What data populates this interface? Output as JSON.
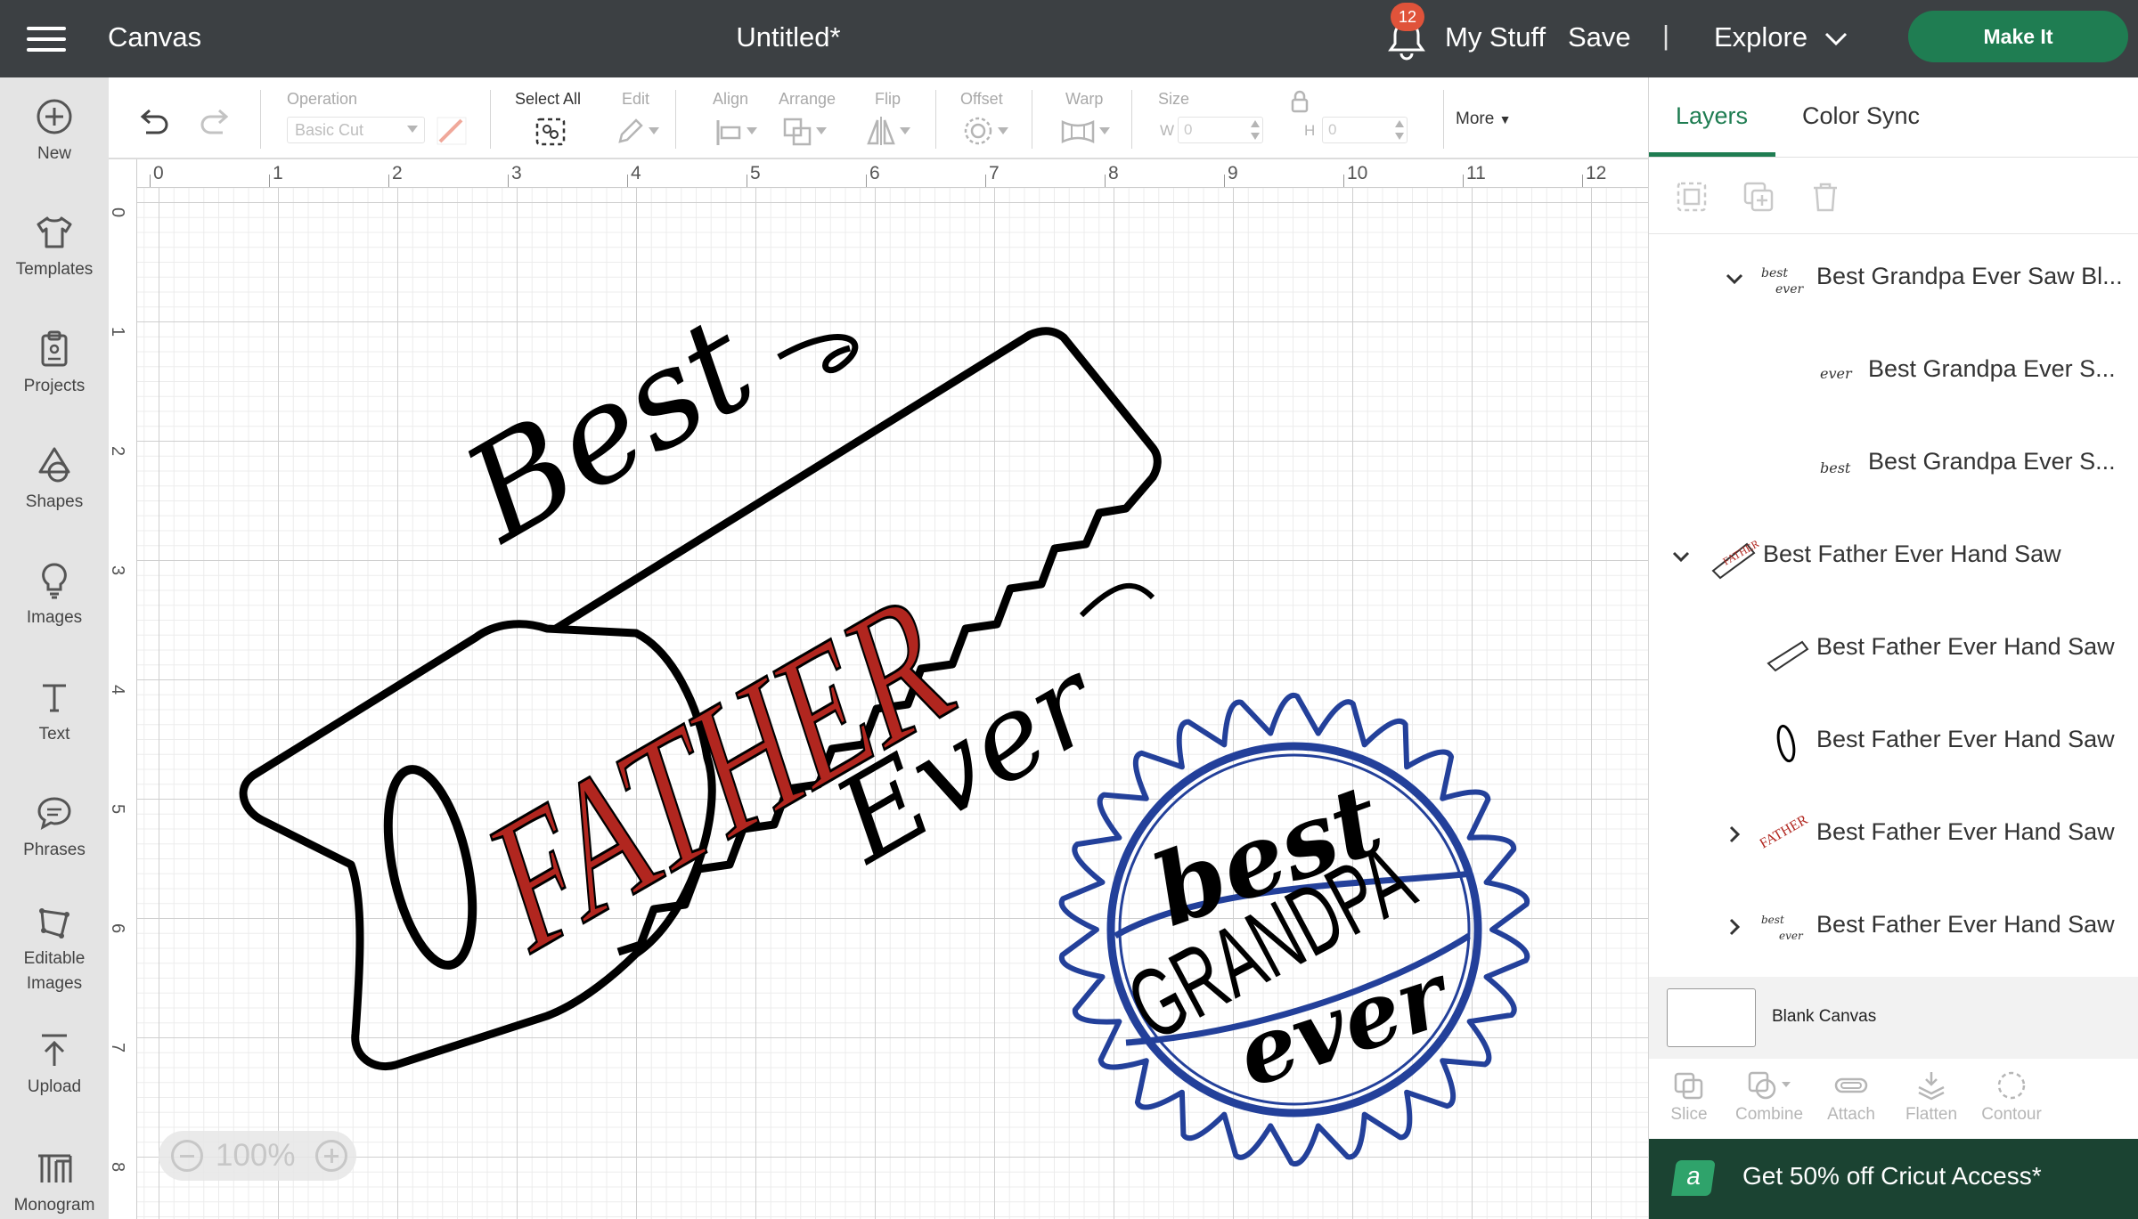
{
  "topbar": {
    "app_title": "Canvas",
    "doc_title": "Untitled*",
    "notifications_count": "12",
    "my_stuff": "My Stuff",
    "save": "Save",
    "separator": "|",
    "explore": "Explore",
    "make_it": "Make It"
  },
  "sidebar": {
    "items": [
      {
        "label": "New",
        "icon": "plus-circle-icon"
      },
      {
        "label": "Templates",
        "icon": "tshirt-icon"
      },
      {
        "label": "Projects",
        "icon": "clipboard-icon"
      },
      {
        "label": "Shapes",
        "icon": "shapes-icon"
      },
      {
        "label": "Images",
        "icon": "lightbulb-icon"
      },
      {
        "label": "Text",
        "icon": "text-t-icon"
      },
      {
        "label": "Phrases",
        "icon": "speech-bubble-icon"
      },
      {
        "label": "Editable",
        "label2": "Images",
        "icon": "editable-images-icon"
      },
      {
        "label": "Upload",
        "icon": "upload-arrow-icon"
      },
      {
        "label": "Monogram",
        "icon": "monogram-icon"
      }
    ]
  },
  "toolbar": {
    "operation_label": "Operation",
    "operation_value": "Basic Cut",
    "select_all": "Select All",
    "edit": "Edit",
    "align": "Align",
    "arrange": "Arrange",
    "flip": "Flip",
    "offset": "Offset",
    "warp": "Warp",
    "size": "Size",
    "w_letter": "W",
    "h_letter": "H",
    "w_value": "0",
    "h_value": "0",
    "more": "More"
  },
  "rulers": {
    "top": [
      "0",
      "1",
      "2",
      "3",
      "4",
      "5",
      "6",
      "7",
      "8",
      "9",
      "10",
      "11",
      "12"
    ],
    "left": [
      "0",
      "1",
      "2",
      "3",
      "4",
      "5",
      "6",
      "7",
      "8"
    ]
  },
  "zoom": {
    "value": "100%"
  },
  "canvas_art": {
    "saw": {
      "best": "Best",
      "father": "FATHER",
      "ever": "Ever"
    },
    "blade": {
      "best": "best",
      "grandpa": "GRANDPA",
      "ever": "ever"
    }
  },
  "panel": {
    "tab_layers": "Layers",
    "tab_color_sync": "Color Sync",
    "layers": [
      {
        "name": "Best Grandpa Ever Saw Bl...",
        "expand": "down"
      },
      {
        "name": "Best Grandpa Ever S...",
        "expand": "none"
      },
      {
        "name": "Best Grandpa Ever S...",
        "expand": "none"
      },
      {
        "name": "Best Father Ever Hand Saw",
        "expand": "down"
      },
      {
        "name": "Best Father Ever Hand Saw",
        "expand": "none"
      },
      {
        "name": "Best Father Ever Hand Saw",
        "expand": "none"
      },
      {
        "name": "Best Father Ever Hand Saw",
        "expand": "right"
      },
      {
        "name": "Best Father Ever Hand Saw",
        "expand": "right"
      }
    ],
    "blank_canvas": "Blank Canvas",
    "bottom_tools": [
      "Slice",
      "Combine",
      "Attach",
      "Flatten",
      "Contour"
    ],
    "promo": "Get 50% off Cricut Access*",
    "promo_logo": "a"
  },
  "colors": {
    "topbar_bg": "#3c4043",
    "accent_green": "#1f7d52",
    "father_red": "#b1261f",
    "grandpa_blue": "#23409a",
    "promo_bg": "#1b4332"
  }
}
